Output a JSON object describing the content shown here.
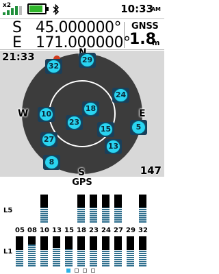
{
  "status_bar": {
    "signal_multiplier": "x2",
    "signal_bars": 4,
    "battery_level": 0.85,
    "bluetooth_icon": "bluetooth-icon",
    "time": "10:33",
    "ampm": "AM"
  },
  "coordinates": {
    "lat_dir": "S",
    "lat_value": "45.000000°",
    "lon_dir": "E",
    "lon_value": "171.000000°",
    "gnss_label": "GNSS",
    "accuracy": "1.8",
    "accuracy_unit": "m"
  },
  "sky_view": {
    "time_label": "21:33",
    "heading_label": "147",
    "compass": {
      "north": "N",
      "south": "S",
      "east": "E",
      "west": "W"
    },
    "satellites": [
      "32",
      "29",
      "24",
      "18",
      "10",
      "23",
      "15",
      "5",
      "27",
      "13",
      "8"
    ],
    "colors": {
      "satellite": "#2ad4f2",
      "background": "#d8d8d8",
      "sky": "#3c3c3c",
      "position_marker": "#d03c1e"
    }
  },
  "signal_graph": {
    "system_label": "GPS",
    "l5_label": "L5",
    "l1_label": "L1",
    "prns": [
      "05",
      "08",
      "10",
      "13",
      "15",
      "18",
      "23",
      "24",
      "27",
      "29",
      "32"
    ],
    "l5_strength": [
      0,
      0,
      1.0,
      0,
      0,
      0.98,
      1.0,
      1.0,
      1.0,
      0,
      0.98
    ],
    "l1_strength": [
      1.0,
      0.55,
      1.0,
      0.85,
      0.95,
      1.0,
      1.0,
      1.0,
      1.0,
      1.0,
      1.0
    ],
    "page_count": 4,
    "active_page": 1
  }
}
